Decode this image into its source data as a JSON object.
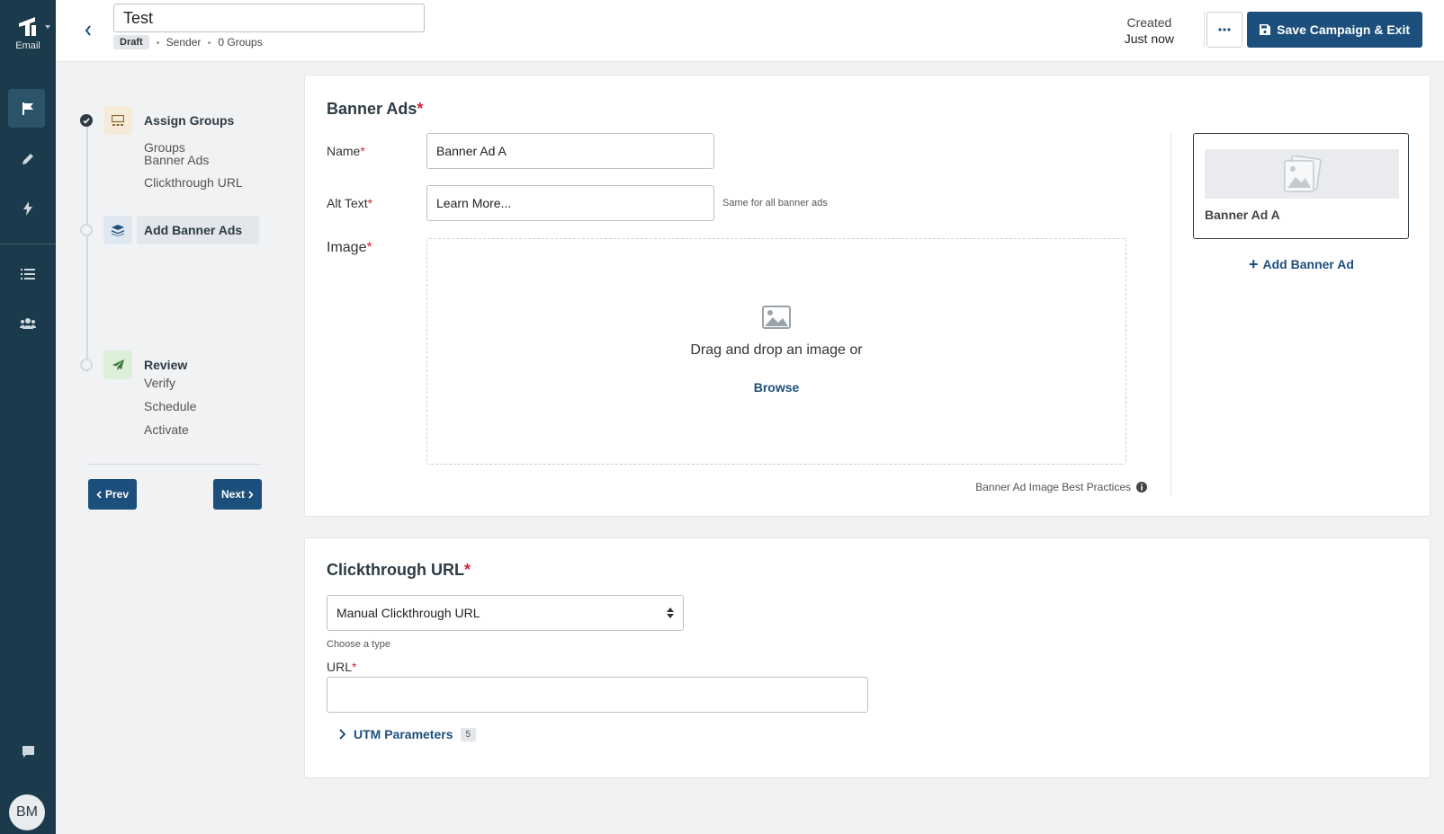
{
  "rail": {
    "logo_label": "Email",
    "avatar_initials": "BM"
  },
  "header": {
    "campaign_title": "Test",
    "status_badge": "Draft",
    "sender": "Sender",
    "groups_count": "0 Groups",
    "created_label": "Created",
    "created_value": "Just now",
    "save_label": "Save Campaign & Exit"
  },
  "steps": [
    {
      "title": "Assign Groups",
      "state": "done",
      "subitems": [
        "Groups"
      ]
    },
    {
      "title": "Add Banner Ads",
      "state": "current",
      "subitems": [
        "Banner Ads",
        "Clickthrough URL"
      ]
    },
    {
      "title": "Review",
      "state": "pending",
      "subitems": [
        "Verify",
        "Schedule",
        "Activate"
      ]
    }
  ],
  "nav": {
    "prev_label": "Prev",
    "next_label": "Next"
  },
  "banner_ads": {
    "title": "Banner Ads",
    "name_label": "Name",
    "name_value": "Banner Ad A",
    "alt_label": "Alt Text",
    "alt_value": "Learn More...",
    "alt_hint": "Same for all banner ads",
    "image_label": "Image",
    "drop_text": "Drag and drop an image or",
    "browse_label": "Browse",
    "best_practices": "Banner Ad Image Best Practices",
    "tile_label": "Banner Ad A",
    "add_label": "Add Banner Ad"
  },
  "clickthrough": {
    "title": "Clickthrough URL",
    "type_value": "Manual Clickthrough URL",
    "type_hint": "Choose a type",
    "url_label": "URL",
    "url_value": "",
    "utm_label": "UTM Parameters",
    "utm_count": "5"
  },
  "colors": {
    "rail": "#1b3a4b",
    "primary": "#1d4f7c",
    "required": "#d0263a"
  }
}
